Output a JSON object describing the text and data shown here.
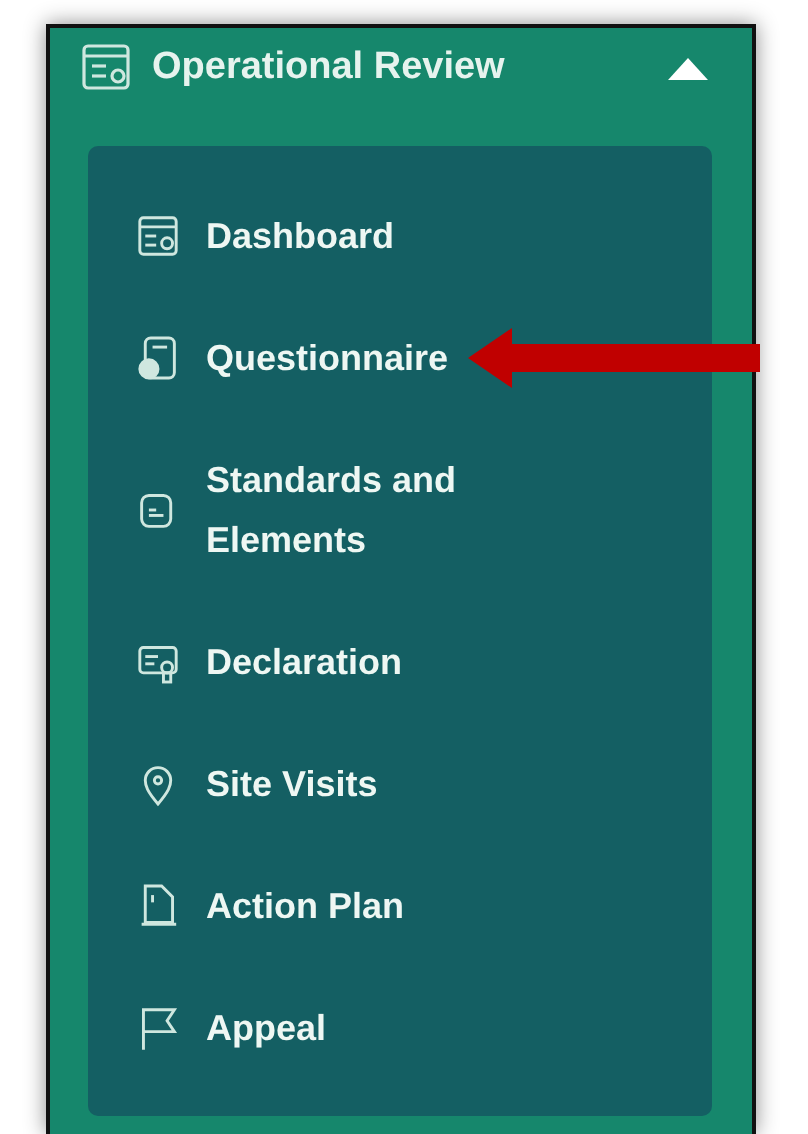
{
  "menu": {
    "title": "Operational Review",
    "expanded": true
  },
  "items": [
    {
      "label": "Dashboard",
      "arrow": false
    },
    {
      "label": "Questionnaire",
      "arrow": true
    },
    {
      "label": "Standards and Elements",
      "arrow": false
    },
    {
      "label": "Declaration",
      "arrow": false
    },
    {
      "label": "Site Visits",
      "arrow": false
    },
    {
      "label": "Action Plan",
      "arrow": false
    },
    {
      "label": "Appeal",
      "arrow": false
    }
  ]
}
